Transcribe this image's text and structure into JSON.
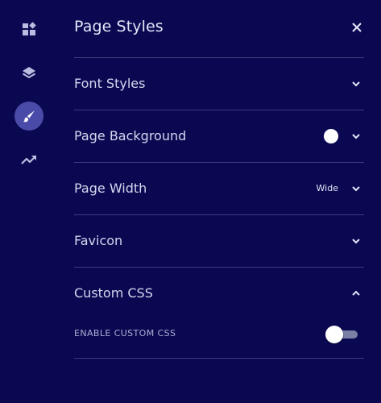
{
  "rail": {
    "items": [
      {
        "icon": "widgets-icon",
        "active": false
      },
      {
        "icon": "layers-icon",
        "active": false
      },
      {
        "icon": "brush-icon",
        "active": true
      },
      {
        "icon": "trending-icon",
        "active": false
      }
    ]
  },
  "panel": {
    "title": "Page Styles",
    "sections": [
      {
        "label": "Font Styles",
        "expanded": false
      },
      {
        "label": "Page Background",
        "expanded": false,
        "color": "#ffffff"
      },
      {
        "label": "Page Width",
        "expanded": false,
        "value": "Wide"
      },
      {
        "label": "Favicon",
        "expanded": false
      },
      {
        "label": "Custom CSS",
        "expanded": true,
        "option_label": "ENABLE CUSTOM CSS",
        "option_enabled": false
      }
    ]
  },
  "colors": {
    "background": "#0b0852",
    "divider": "#3b3b7a",
    "active_rail": "#4a4aa8"
  }
}
